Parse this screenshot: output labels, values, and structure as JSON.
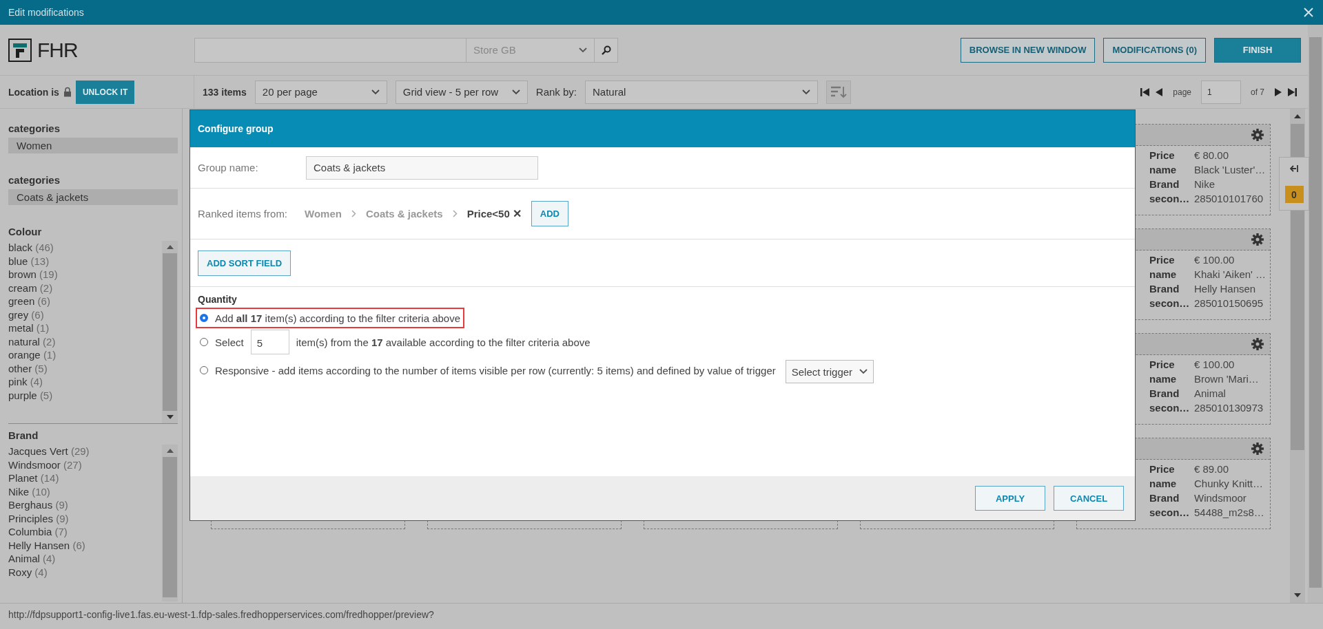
{
  "window": {
    "title": "Edit modifications"
  },
  "header": {
    "logo": "FHR",
    "store": "Store GB",
    "buttons": [
      {
        "label": "BROWSE IN NEW WINDOW",
        "kind": "outline"
      },
      {
        "label": "MODIFICATIONS (0)",
        "kind": "outline"
      },
      {
        "label": "FINISH",
        "kind": "primary"
      }
    ]
  },
  "location": {
    "label": "Location is",
    "locked": true,
    "button": "UNLOCK IT"
  },
  "toolbar": {
    "count": "133 items",
    "per_page": "20 per page",
    "view": "Grid view - 5 per row",
    "rank_label": "Rank by:",
    "rank": "Natural",
    "page_label": "page",
    "page": "1",
    "of": "of 7"
  },
  "sidebar": {
    "category_groups": [
      {
        "title": "categories",
        "value": "Women"
      },
      {
        "title": "categories",
        "value": "Coats & jackets"
      }
    ],
    "facets": [
      {
        "title": "Colour",
        "items": [
          {
            "label": "black",
            "count": "(46)"
          },
          {
            "label": "blue",
            "count": "(13)"
          },
          {
            "label": "brown",
            "count": "(19)"
          },
          {
            "label": "cream",
            "count": "(2)"
          },
          {
            "label": "green",
            "count": "(6)"
          },
          {
            "label": "grey",
            "count": "(6)"
          },
          {
            "label": "metal",
            "count": "(1)"
          },
          {
            "label": "natural",
            "count": "(2)"
          },
          {
            "label": "orange",
            "count": "(1)"
          },
          {
            "label": "other",
            "count": "(5)"
          },
          {
            "label": "pink",
            "count": "(4)"
          },
          {
            "label": "purple",
            "count": "(5)"
          }
        ]
      },
      {
        "title": "Brand",
        "items": [
          {
            "label": "Jacques Vert",
            "count": "(29)"
          },
          {
            "label": "Windsmoor",
            "count": "(27)"
          },
          {
            "label": "Planet",
            "count": "(14)"
          },
          {
            "label": "Nike",
            "count": "(10)"
          },
          {
            "label": "Berghaus",
            "count": "(9)"
          },
          {
            "label": "Principles",
            "count": "(9)"
          },
          {
            "label": "Columbia",
            "count": "(7)"
          },
          {
            "label": "Helly Hansen",
            "count": "(6)"
          },
          {
            "label": "Animal",
            "count": "(4)"
          },
          {
            "label": "Roxy",
            "count": "(4)"
          }
        ]
      }
    ]
  },
  "products": [
    {
      "fields": [
        {
          "label": "Price",
          "value": "€ 80.00"
        },
        {
          "label": "name",
          "value": "Black 'Luster'…"
        },
        {
          "label": "Brand",
          "value": "Nike"
        },
        {
          "label": "secon…",
          "value": "285010101760"
        }
      ]
    },
    {
      "fields": [
        {
          "label": "Price",
          "value": "€ 100.00"
        },
        {
          "label": "name",
          "value": "Khaki 'Aiken' …"
        },
        {
          "label": "Brand",
          "value": "Helly Hansen"
        },
        {
          "label": "secon…",
          "value": "285010150695"
        }
      ]
    },
    {
      "fields": [
        {
          "label": "Price",
          "value": "€ 100.00"
        },
        {
          "label": "name",
          "value": "Brown 'Mari…"
        },
        {
          "label": "Brand",
          "value": "Animal"
        },
        {
          "label": "secon…",
          "value": "285010130973"
        }
      ]
    },
    {
      "fields": [
        {
          "label": "Price",
          "value": "€ 89.00"
        },
        {
          "label": "name",
          "value": "Chunky Knitt…"
        },
        {
          "label": "Brand",
          "value": "Windsmoor"
        },
        {
          "label": "secon…",
          "value": "54488_m2s8…"
        }
      ]
    }
  ],
  "side_panel": {
    "badge": "0"
  },
  "dialog": {
    "title": "Configure group",
    "group_name_label": "Group name:",
    "group_name": "Coats & jackets",
    "ranked_label": "Ranked items from:",
    "breadcrumb": [
      {
        "label": "Women",
        "kind": "link"
      },
      {
        "label": "Coats & jackets",
        "kind": "link"
      },
      {
        "label": "Price<50",
        "kind": "current",
        "remove": "✕"
      }
    ],
    "add_button": "ADD",
    "sort_button": "ADD SORT FIELD",
    "quantity_label": "Quantity",
    "options": [
      {
        "kind": "all",
        "text": "Add **all 17** item(s) according to the filter criteria above",
        "selected": true,
        "highlighted": true
      },
      {
        "kind": "select",
        "label": "Select",
        "value": "5",
        "text": "item(s) from the **17** available according to the filter criteria above",
        "selected": false,
        "highlighted": false
      },
      {
        "kind": "responsive",
        "text": "Responsive - add items according to the number of items visible per row (currently: 5 items) and defined by value of trigger",
        "select": "Select trigger",
        "selected": false,
        "highlighted": false
      }
    ],
    "buttons": [
      "APPLY",
      "CANCEL"
    ]
  },
  "status_bar": {
    "url": "http://fdpsupport1-config-live1.fas.eu-west-1.fdp-sales.fredhopperservices.com/fredhopper/preview?"
  }
}
